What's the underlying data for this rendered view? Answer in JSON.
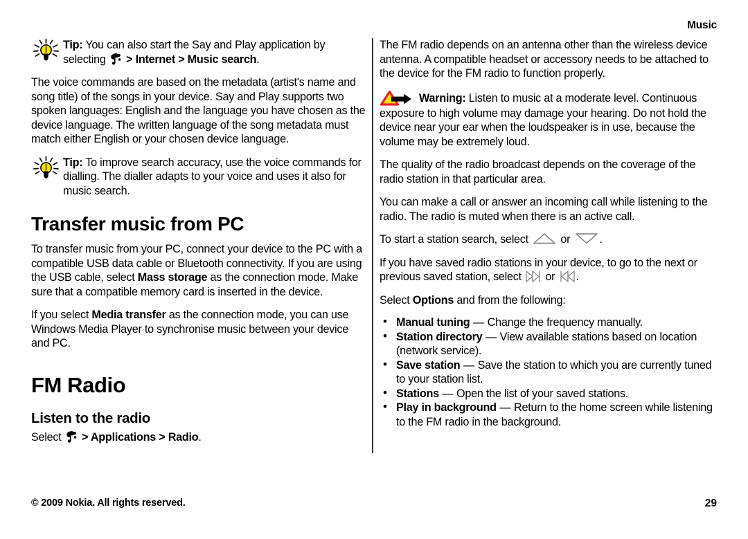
{
  "document": {
    "running_head": "Music",
    "page_number": "29",
    "copyright": "© 2009 Nokia. All rights reserved."
  },
  "left_column": {
    "tip1": {
      "icon": "lightbulb-icon",
      "label": "Tip:",
      "text_before_icon": " You can also start the Say and Play application by selecting ",
      "menu_icon": "nokia-menu-key-icon",
      "sep1": " > ",
      "path1": "Internet",
      "sep2": " > ",
      "path2": "Music search",
      "period": "."
    },
    "para1": "The voice commands are based on the metadata (artist's name and song title) of the songs in your device. Say and Play supports two spoken languages: English and the language you have chosen as the device language. The written language of the song metadata must match either English or your chosen device language.",
    "tip2": {
      "icon": "lightbulb-icon",
      "label": "Tip:",
      "text": " To improve search accuracy, use the voice commands for dialling. The dialler adapts to your voice and uses it also for music search."
    },
    "heading_transfer": "Transfer music from PC",
    "para2_a": "To transfer music from your PC, connect your device to the PC with a compatible USB data cable or Bluetooth connectivity. If you are using the USB cable, select ",
    "para2_bold": "Mass storage",
    "para2_b": " as the connection mode. Make sure that a compatible memory card is inserted in the device.",
    "para3_a": "If you select ",
    "para3_bold": "Media transfer",
    "para3_b": " as the connection mode, you can use Windows Media Player to synchronise music between your device and PC.",
    "heading_fm_radio": "FM Radio",
    "heading_listen": "Listen to the radio",
    "select_line": {
      "prefix": "Select ",
      "menu_icon": "nokia-menu-key-icon",
      "sep1": " > ",
      "path1": "Applications",
      "sep2": " > ",
      "path2": "Radio",
      "period": "."
    }
  },
  "right_column": {
    "para1": "The FM radio depends on an antenna other than the wireless device antenna. A compatible headset or accessory needs to be attached to the device for the FM radio to function properly.",
    "warning": {
      "icon": "warning-triangle-arrow-icon",
      "label": "Warning:",
      "text": "  Listen to music at a moderate level. Continuous exposure to high volume may damage your hearing. Do not hold the device near your ear when the loudspeaker is in use, because the volume may be extremely loud."
    },
    "para2": "The quality of the radio broadcast depends on the coverage of the radio station in that particular area.",
    "para3": "You can make a call or answer an incoming call while listening to the radio. The radio is muted when there is an active call.",
    "para4": {
      "prefix": "To start a station search, select ",
      "icon_up": "triangle-up-icon",
      "middle": " or ",
      "icon_down": "triangle-down-icon",
      "suffix": "."
    },
    "para5": {
      "prefix": "If you have saved radio stations in your device, to go to the next or previous saved station, select ",
      "icon_next": "skip-next-icon",
      "middle": " or ",
      "icon_prev": "skip-previous-icon",
      "suffix": "."
    },
    "options_line_a": "Select ",
    "options_line_bold": "Options",
    "options_line_b": " and from the following:",
    "bullets": [
      {
        "term": "Manual tuning",
        "dash": "  —  ",
        "desc": "Change the frequency manually."
      },
      {
        "term": "Station directory",
        "dash": "  —  ",
        "desc": "View available stations based on location (network service)."
      },
      {
        "term": "Save station",
        "dash": "  —  ",
        "desc": "Save the station to which you are currently tuned to your station list."
      },
      {
        "term": "Stations",
        "dash": "  —  ",
        "desc": "Open the list of your saved stations."
      },
      {
        "term": "Play in background",
        "dash": "  —  ",
        "desc": "Return to the home screen while listening to the FM radio in the background."
      }
    ]
  },
  "colors": {
    "bulb_yellow": "#F5E400",
    "warning_red": "#E8222A",
    "warning_yellow": "#FFE800",
    "divider": "#2b3a40",
    "text": "#000000"
  }
}
